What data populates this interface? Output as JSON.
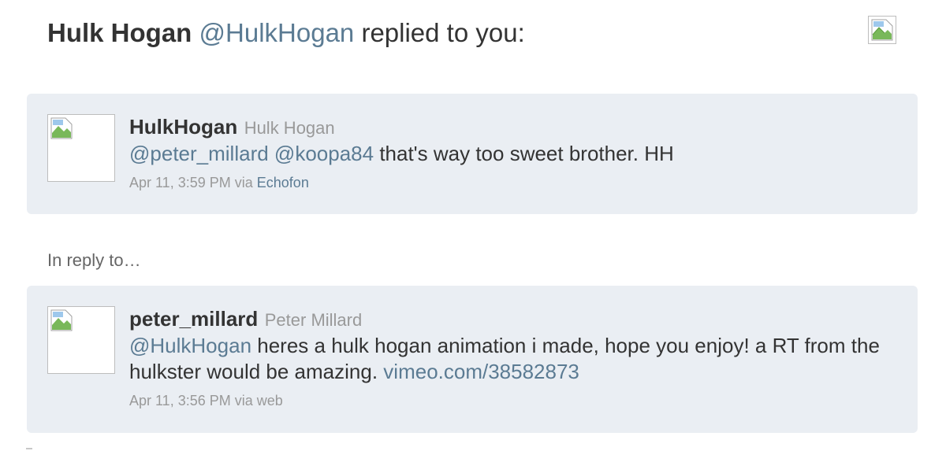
{
  "header": {
    "name": "Hulk Hogan",
    "handle": "@HulkHogan",
    "text": "replied to you:",
    "image_icon": "broken-image-icon"
  },
  "reply_tweet": {
    "avatar_icon": "broken-image-icon",
    "screen_name": "HulkHogan",
    "full_name": "Hulk Hogan",
    "mention1": "@peter_millard",
    "mention2": "@koopa84",
    "text": "that's way too sweet brother. HH",
    "timestamp": "Apr 11, 3:59 PM",
    "via": "via",
    "source": "Echofon"
  },
  "in_reply_to_label": "In reply to…",
  "original_tweet": {
    "avatar_icon": "broken-image-icon",
    "screen_name": "peter_millard",
    "full_name": "Peter Millard",
    "mention": "@HulkHogan",
    "text": "heres a hulk hogan animation i made, hope you enjoy! a RT from the hulkster would be amazing.",
    "link": "vimeo.com/38582873",
    "timestamp": "Apr 11, 3:56 PM",
    "via": "via",
    "source": "web"
  },
  "colors": {
    "card_background": "#eaeef3",
    "link": "#5b7b93",
    "muted": "#999999",
    "text": "#333333"
  }
}
